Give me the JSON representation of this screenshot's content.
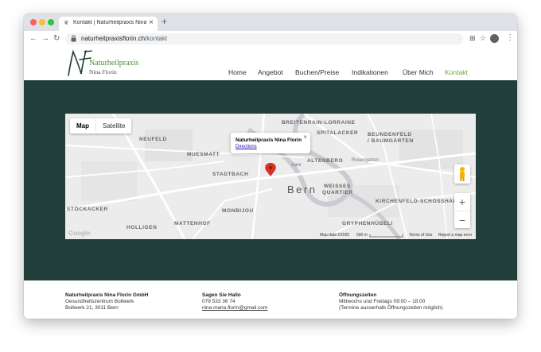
{
  "browser": {
    "tab_title": "Kontakt | Naturheilpraxis Nina Florin",
    "url_domain": "naturheilpraxisflorin.ch",
    "url_path": "/kontakt"
  },
  "site": {
    "logo_line1": "Naturheilpraxis",
    "logo_line2": "Nina Florin",
    "nav": [
      "Home",
      "Angebot",
      "Buchen/Preise",
      "Indikationen",
      "Über Mich",
      "Kontakt"
    ],
    "colors": {
      "accent": "#6aa83f",
      "band": "#223f3b"
    }
  },
  "map": {
    "type_map": "Map",
    "type_satellite": "Satellite",
    "marker_title": "Naturheilpraxis Nina Florin",
    "directions": "Directions",
    "labels": {
      "breitenrain": "BREITENRAIN-LORRAINE",
      "spitalacker": "SPITALACKER",
      "beundenfeld": "BEUNDENFELD",
      "baumgarten": "/ BAUMGÄRTEN",
      "neufeld": "NEUFELD",
      "muesmatt": "MUESMATT",
      "altenberg": "ALTENBERG",
      "rosengarten": "Rosengarten",
      "stadtbach": "STADTBACH",
      "bern": "Bern",
      "weissesquartier1": "WEISSES",
      "weissesquartier2": "QUARTIER",
      "kirchenfeld": "KIRCHENFELD-SCHOSSHALDE",
      "stoeckacker": "STÖCKACKER",
      "monbijou": "MONBIJOU",
      "mattenhof": "MATTENHOF",
      "holligen": "HOLLIGEN",
      "gryphenhuebeli": "GRYPHENHÜBELI",
      "aare": "Aare"
    },
    "map_data": "Map data ©2020",
    "scale": "500 m",
    "terms": "Terms of Use",
    "report": "Report a map error",
    "google": "Google"
  },
  "footer": {
    "col1": [
      "Naturheilpraxis Nina Florin GmbH",
      "Gesundheitszentrum Bollwerk",
      "Bollwerk 21, 3011 Bern"
    ],
    "col2_title": "Sagen Sie Hallo",
    "col2_phone": "079 533 36 74",
    "col2_email": "nina.maria.florin@gmail.com",
    "col3_title": "Öffnungszeiten",
    "col3_lines": [
      "Mittwochs und Freitags 09:00 – 18:00",
      "(Termine ausserhalb Öffnungszeiten möglich)"
    ]
  }
}
